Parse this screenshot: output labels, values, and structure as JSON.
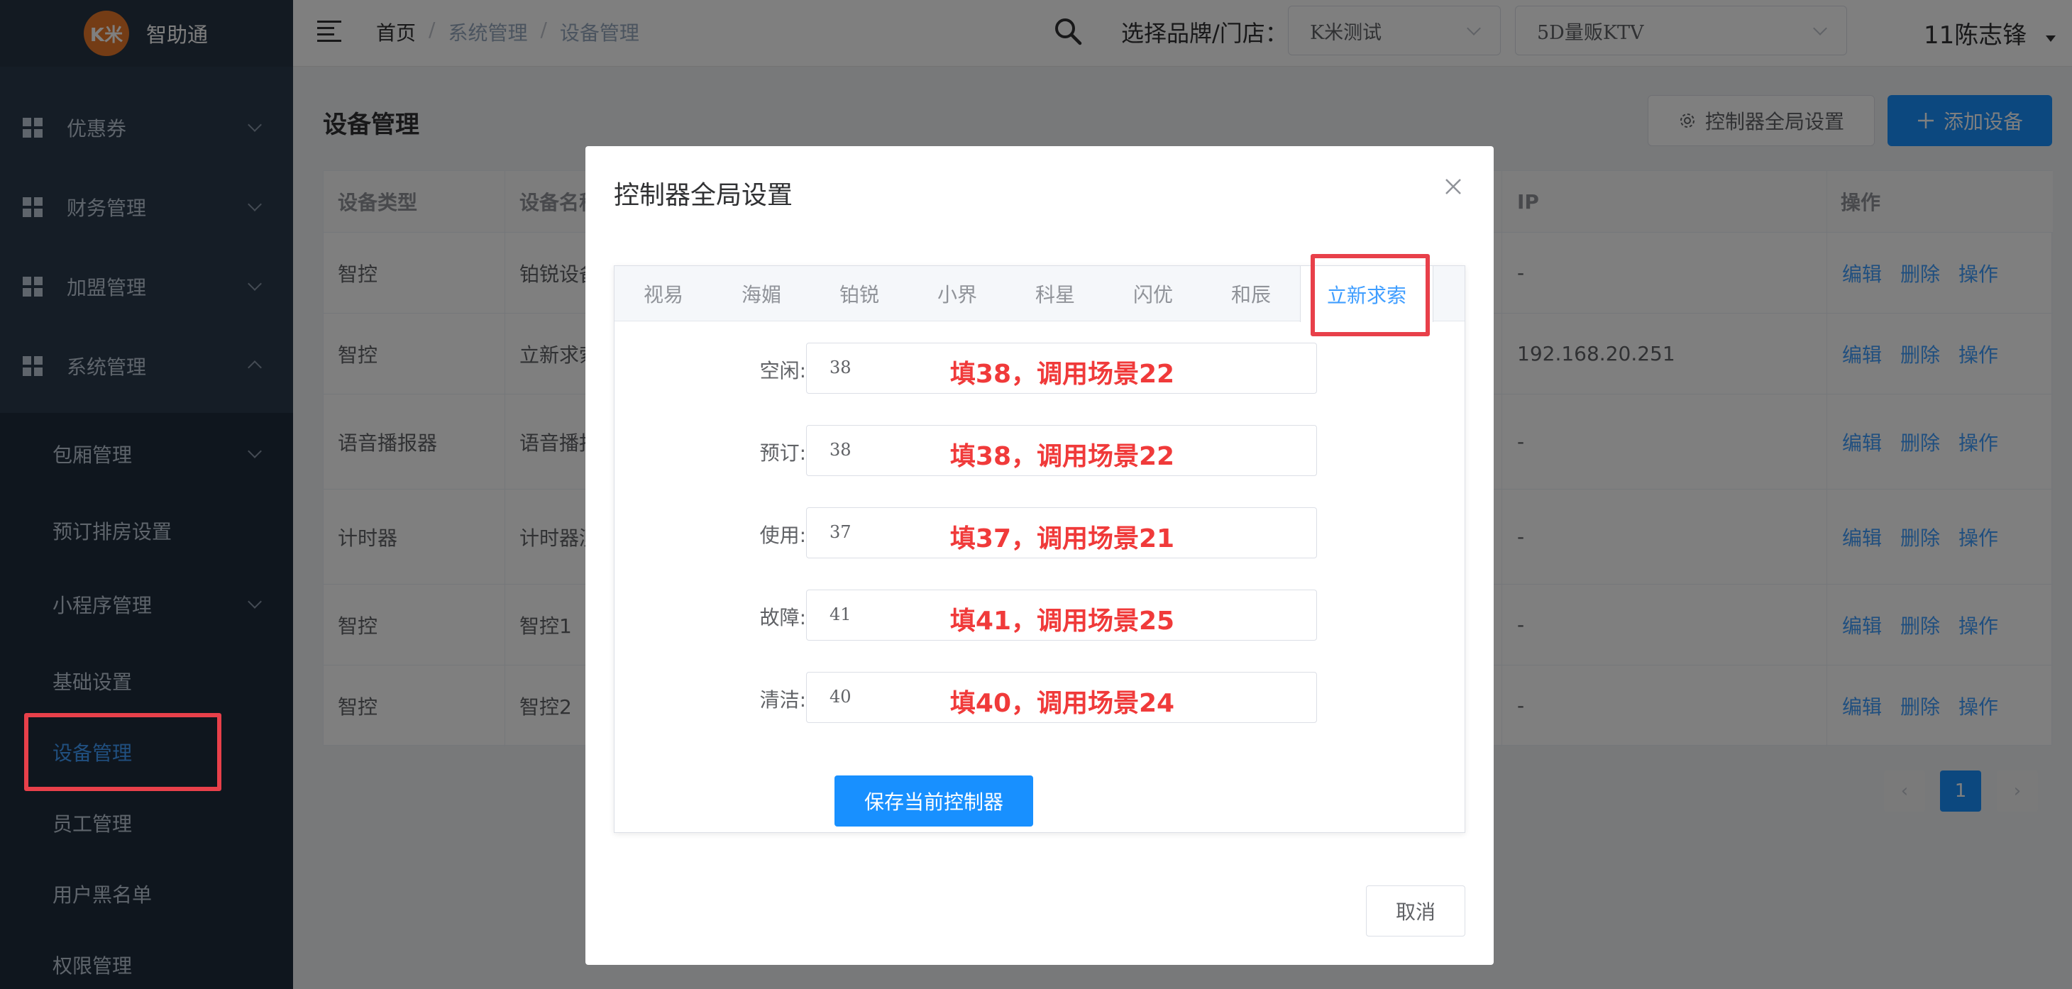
{
  "app": {
    "logo_text": "K米",
    "name": "智助通"
  },
  "sidebar": {
    "items": [
      {
        "label": "优惠券"
      },
      {
        "label": "财务管理"
      },
      {
        "label": "加盟管理"
      },
      {
        "label": "系统管理"
      }
    ],
    "sub_items": [
      {
        "label": "包厢管理"
      },
      {
        "label": "预订排房设置"
      },
      {
        "label": "小程序管理"
      },
      {
        "label": "基础设置"
      },
      {
        "label": "设备管理"
      },
      {
        "label": "员工管理"
      },
      {
        "label": "用户黑名单"
      },
      {
        "label": "权限管理"
      }
    ]
  },
  "header": {
    "breadcrumb": [
      "首页",
      "/",
      "系统管理",
      "/",
      "设备管理"
    ],
    "brand_label": "选择品牌/门店：",
    "brand_select": "K米测试",
    "store_select": "5D量贩KTV",
    "user": "11陈志锋"
  },
  "page": {
    "title": "设备管理",
    "btn_global": "控制器全局设置",
    "btn_add": "添加设备",
    "table": {
      "headers": [
        "设备类型",
        "设备名称",
        "IP",
        "操作"
      ],
      "rows": [
        {
          "type": "智控",
          "name": "铂锐设备",
          "ip": "-"
        },
        {
          "type": "智控",
          "name": "立新求索",
          "ip": "192.168.20.251"
        },
        {
          "type": "语音播报器",
          "name": "语音播报",
          "ip": "-"
        },
        {
          "type": "计时器",
          "name": "计时器测",
          "ip": "-"
        },
        {
          "type": "智控",
          "name": "智控1",
          "ip": "-"
        },
        {
          "type": "智控",
          "name": "智控2",
          "ip": "-"
        }
      ],
      "ops": [
        "编辑",
        "删除",
        "操作"
      ]
    },
    "pagination": {
      "prev": "‹",
      "current": "1",
      "next": "›"
    }
  },
  "modal": {
    "title": "控制器全局设置",
    "tabs": [
      "视易",
      "海媚",
      "铂锐",
      "小界",
      "科星",
      "闪优",
      "和辰",
      "立新求索"
    ],
    "active_tab": 7,
    "fields": [
      {
        "label": "空闲:",
        "value": "38",
        "note": "填38，调用场景22"
      },
      {
        "label": "预订:",
        "value": "38",
        "note": "填38，调用场景22"
      },
      {
        "label": "使用:",
        "value": "37",
        "note": "填37，调用场景21"
      },
      {
        "label": "故障:",
        "value": "41",
        "note": "填41，调用场景25"
      },
      {
        "label": "清洁:",
        "value": "40",
        "note": "填40，调用场景24"
      }
    ],
    "save_label": "保存当前控制器",
    "cancel_label": "取消"
  },
  "colors": {
    "primary": "#1890ff",
    "sidebar": "#1f2d3d",
    "annotation": "#f03a3a",
    "highlight_box": "#e8404a"
  }
}
